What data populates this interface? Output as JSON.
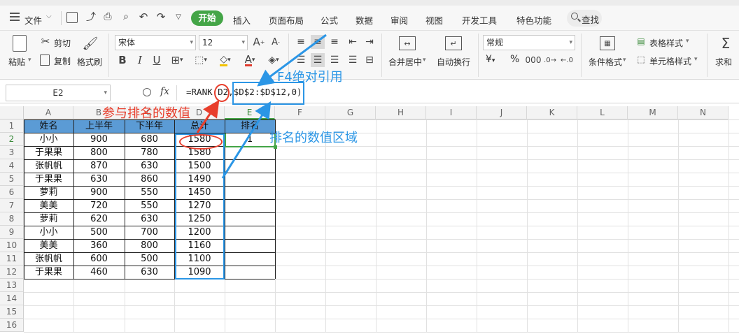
{
  "menubar": {
    "file_label": "文件",
    "tabs": [
      "开始",
      "插入",
      "页面布局",
      "公式",
      "数据",
      "审阅",
      "视图",
      "开发工具",
      "特色功能"
    ],
    "search_label": "查找"
  },
  "toolbar": {
    "paste_label": "粘贴",
    "cut_label": "剪切",
    "copy_label": "复制",
    "format_painter_label": "格式刷",
    "font_name": "宋体",
    "font_size": "12",
    "merge_label": "合并居中",
    "wrap_label": "自动换行",
    "number_format": "常规",
    "currency_symbol": "¥",
    "percent_symbol": "%",
    "conditional_format_label": "条件格式",
    "table_style_label": "表格样式",
    "cell_style_label": "单元格样式",
    "sum_label": "求和"
  },
  "formula_bar": {
    "name_box": "E2",
    "fx": "fx",
    "formula": "=RANK(D2,$D$2:$D$12,0)"
  },
  "sheet": {
    "columns": [
      "A",
      "B",
      "C",
      "D",
      "E",
      "F",
      "G",
      "H",
      "I",
      "J",
      "K",
      "L",
      "M",
      "N"
    ],
    "rows": [
      "1",
      "2",
      "3",
      "4",
      "5",
      "6",
      "7",
      "8",
      "9",
      "10",
      "11",
      "12",
      "13",
      "14",
      "15",
      "16"
    ],
    "headers": [
      "姓名",
      "上半年",
      "下半年",
      "总计",
      "排名"
    ],
    "data": [
      [
        "小小",
        "900",
        "680",
        "1580",
        "1"
      ],
      [
        "于果果",
        "800",
        "780",
        "1580",
        ""
      ],
      [
        "张帆帆",
        "870",
        "630",
        "1500",
        ""
      ],
      [
        "于果果",
        "630",
        "860",
        "1490",
        ""
      ],
      [
        "萝莉",
        "900",
        "550",
        "1450",
        ""
      ],
      [
        "美美",
        "720",
        "550",
        "1270",
        ""
      ],
      [
        "萝莉",
        "620",
        "630",
        "1250",
        ""
      ],
      [
        "小小",
        "500",
        "700",
        "1200",
        ""
      ],
      [
        "美美",
        "360",
        "800",
        "1160",
        ""
      ],
      [
        "张帆帆",
        "600",
        "500",
        "1100",
        ""
      ],
      [
        "于果果",
        "460",
        "630",
        "1090",
        ""
      ]
    ]
  },
  "annotations": {
    "value_label": "参与排名的数值",
    "f4_label": "F4绝对引用",
    "range_label": "排名的数值区域"
  },
  "colors": {
    "accent_green": "#44a547",
    "header_fill": "#5b9bd5",
    "annotation_red": "#e83e2c",
    "annotation_blue": "#2b96e6"
  }
}
